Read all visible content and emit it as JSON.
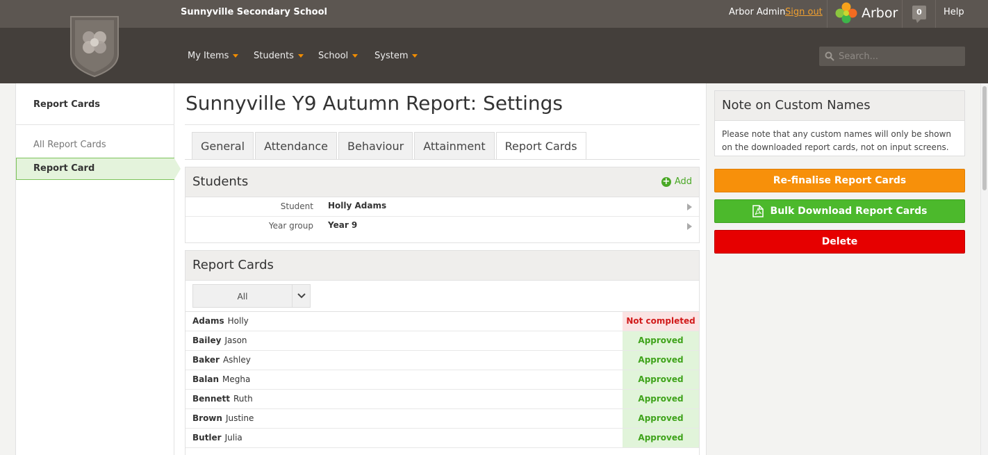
{
  "header": {
    "school_name": "Sunnyville Secondary School",
    "user_name": "Arbor Admin",
    "sign_out": "Sign out",
    "brand": "Arbor",
    "notifications": "0",
    "help": "Help",
    "search_placeholder": "Search...",
    "nav": [
      "My Items",
      "Students",
      "School",
      "System"
    ]
  },
  "sidebar": {
    "heading": "Report Cards",
    "links": [
      "All Report Cards"
    ],
    "active": "Report Card"
  },
  "main": {
    "title": "Sunnyville Y9 Autumn Report: Settings",
    "tabs": [
      "General",
      "Attendance",
      "Behaviour",
      "Attainment",
      "Report Cards"
    ],
    "active_tab": "Report Cards",
    "students_panel": {
      "title": "Students",
      "add_label": "Add",
      "rows": [
        {
          "label": "Student",
          "value": "Holly Adams"
        },
        {
          "label": "Year group",
          "value": "Year 9"
        }
      ]
    },
    "report_cards_panel": {
      "title": "Report Cards",
      "filter_value": "All",
      "rows": [
        {
          "last": "Adams",
          "first": "Holly",
          "status": "Not completed"
        },
        {
          "last": "Bailey",
          "first": "Jason",
          "status": "Approved"
        },
        {
          "last": "Baker",
          "first": "Ashley",
          "status": "Approved"
        },
        {
          "last": "Balan",
          "first": "Megha",
          "status": "Approved"
        },
        {
          "last": "Bennett",
          "first": "Ruth",
          "status": "Approved"
        },
        {
          "last": "Brown",
          "first": "Justine",
          "status": "Approved"
        },
        {
          "last": "Butler",
          "first": "Julia",
          "status": "Approved"
        }
      ]
    }
  },
  "right": {
    "note_title": "Note on Custom Names",
    "note_body": "Please note that any custom names will only be shown on the downloaded report cards, not on input screens.",
    "btn_refinalise": "Re-finalise Report Cards",
    "btn_bulk_download": "Bulk Download Report Cards",
    "btn_delete": "Delete"
  },
  "colors": {
    "accent_orange": "#f7900a",
    "accent_green": "#4cb92c",
    "danger_red": "#e60000",
    "approved_text": "#3fa31b",
    "not_completed_text": "#d11a1a"
  }
}
